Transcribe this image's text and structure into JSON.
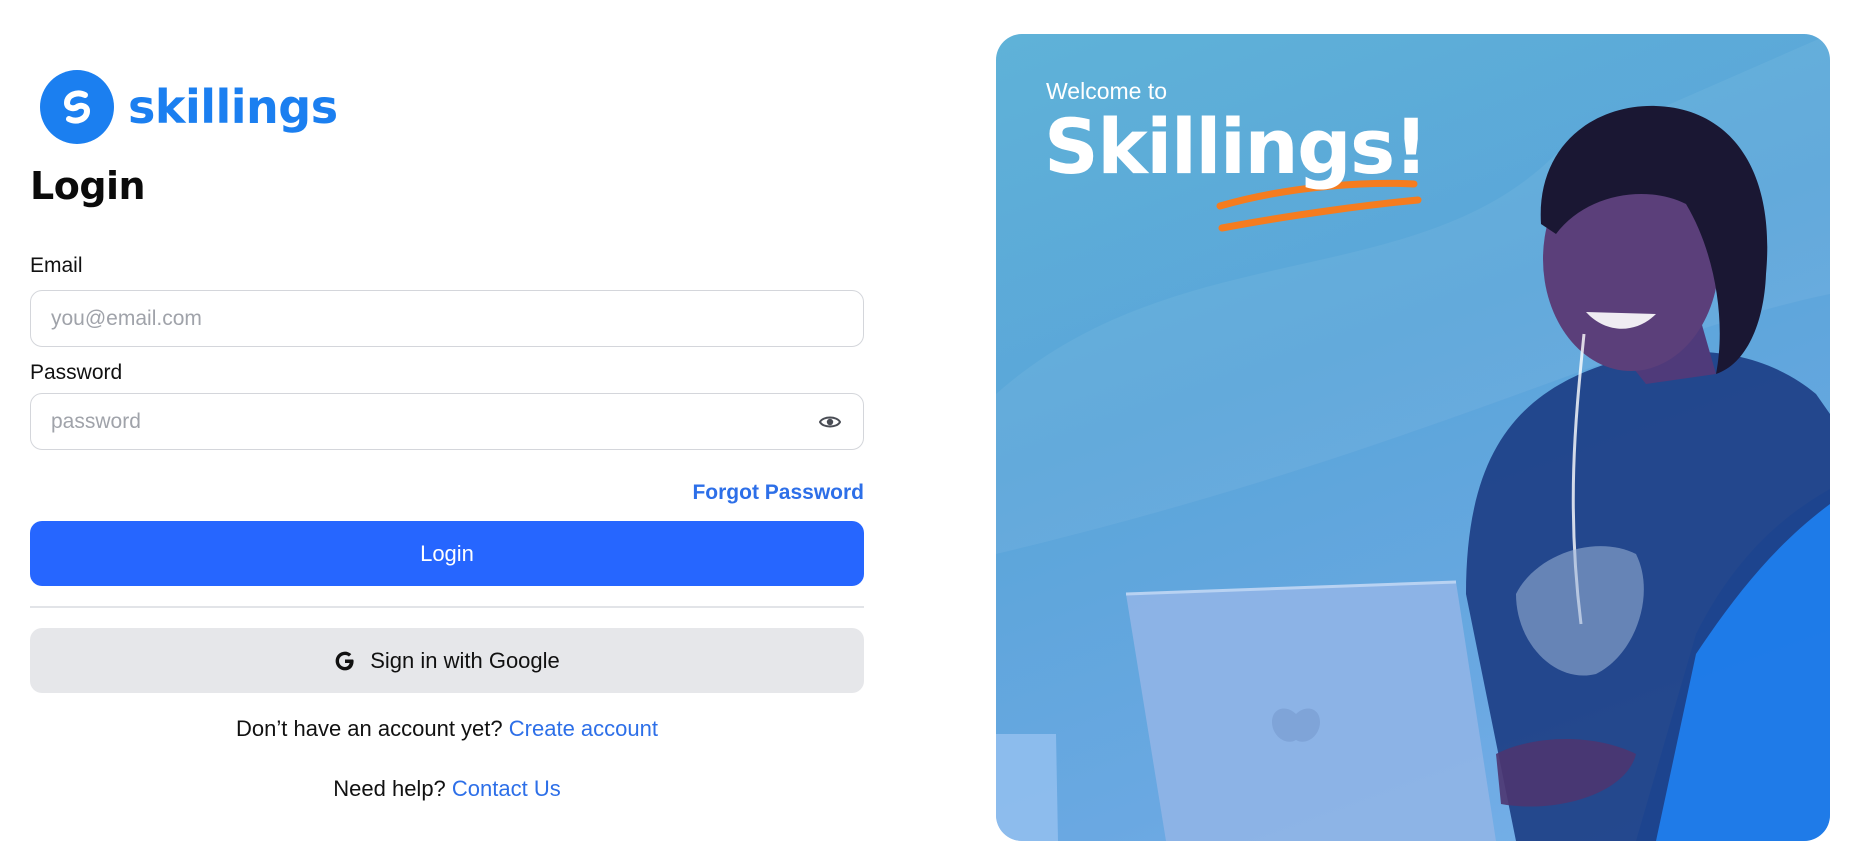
{
  "brand": {
    "name": "skillings",
    "color": "#1b7ff0",
    "logo_icon": "skillings-s-logo-icon"
  },
  "form": {
    "title": "Login",
    "email_label": "Email",
    "email_placeholder": "you@email.com",
    "password_label": "Password",
    "password_placeholder": "password",
    "password_toggle_icon": "eye-icon",
    "forgot_password": "Forgot Password",
    "login_button": "Login",
    "google_button": "Sign in with Google",
    "google_icon": "google-g-icon",
    "signup_prompt": "Don’t have an account yet?",
    "signup_link": "Create account",
    "help_prompt": "Need help?",
    "help_link": "Contact Us"
  },
  "hero": {
    "welcome": "Welcome to",
    "title": "Skillings!",
    "accent_color": "#f57c1f",
    "image": "man-smiling-with-laptop-photo"
  },
  "colors": {
    "primary_button": "#2666ff",
    "link": "#2d6fe8",
    "secondary_button": "#e6e7ea"
  }
}
